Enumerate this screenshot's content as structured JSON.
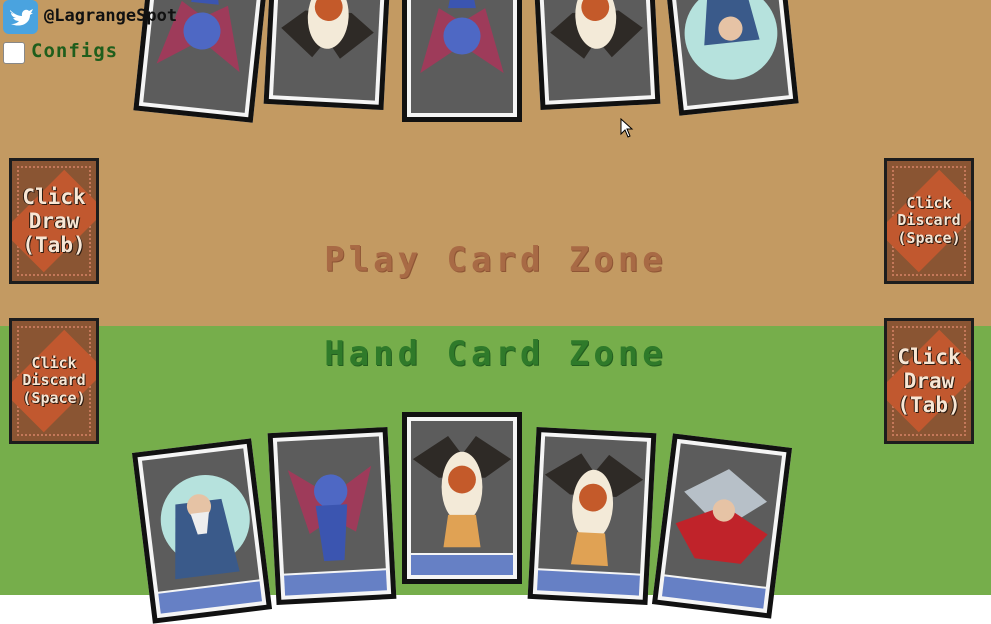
{
  "header": {
    "handle": "@LagrangeSpot",
    "twitter_icon": "twitter-icon"
  },
  "config": {
    "label": "Configs",
    "checked": false
  },
  "zones": {
    "play": "Play Card Zone",
    "hand": "Hand Card Zone"
  },
  "decks": {
    "top_left": "Click\nDraw\n(Tab)",
    "top_right": "Click\nDiscard\n(Space)",
    "bottom_left": "Click\nDiscard\n(Space)",
    "bottom_right": "Click\nDraw\n(Tab)"
  },
  "opponent_hand": [
    "gargoyle",
    "bat-winged-lion",
    "gargoyle",
    "bat-winged-lion",
    "wizard"
  ],
  "player_hand": [
    "wizard",
    "gargoyle",
    "bat-winged-lion",
    "bat-winged-lion",
    "red-dragon"
  ],
  "colors": {
    "play_zone": "#c39a62",
    "hand_zone": "#76ae4b",
    "deck": "#8a5533"
  }
}
